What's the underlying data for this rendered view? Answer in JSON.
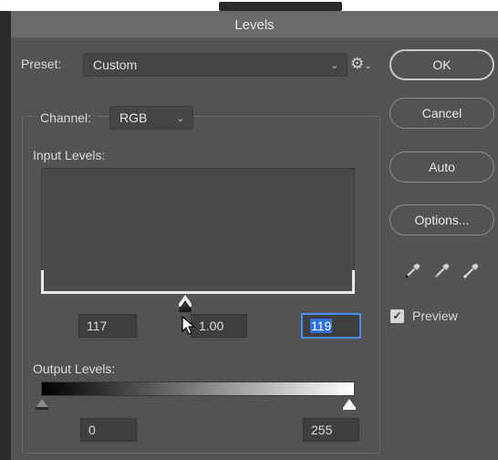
{
  "window": {
    "title": "Levels"
  },
  "preset": {
    "label": "Preset:",
    "value": "Custom",
    "chevron_icon": "chevron-down-icon",
    "settings_icon": "gear-icon"
  },
  "channel": {
    "label": "Channel:",
    "value": "RGB"
  },
  "input_levels": {
    "label": "Input Levels:",
    "black": "117",
    "gamma": "1.00",
    "white": "119"
  },
  "output_levels": {
    "label": "Output Levels:",
    "black": "0",
    "white": "255"
  },
  "buttons": {
    "ok": "OK",
    "cancel": "Cancel",
    "auto": "Auto",
    "options": "Options..."
  },
  "eyedroppers": [
    "black-eyedropper-icon",
    "gray-eyedropper-icon",
    "white-eyedropper-icon"
  ],
  "preview": {
    "label": "Preview",
    "checked": true
  },
  "colors": {
    "panel": "#535353",
    "field": "#3f3f3f",
    "highlight": "#2f6fd6",
    "focus_ring": "#4b8ef0"
  }
}
